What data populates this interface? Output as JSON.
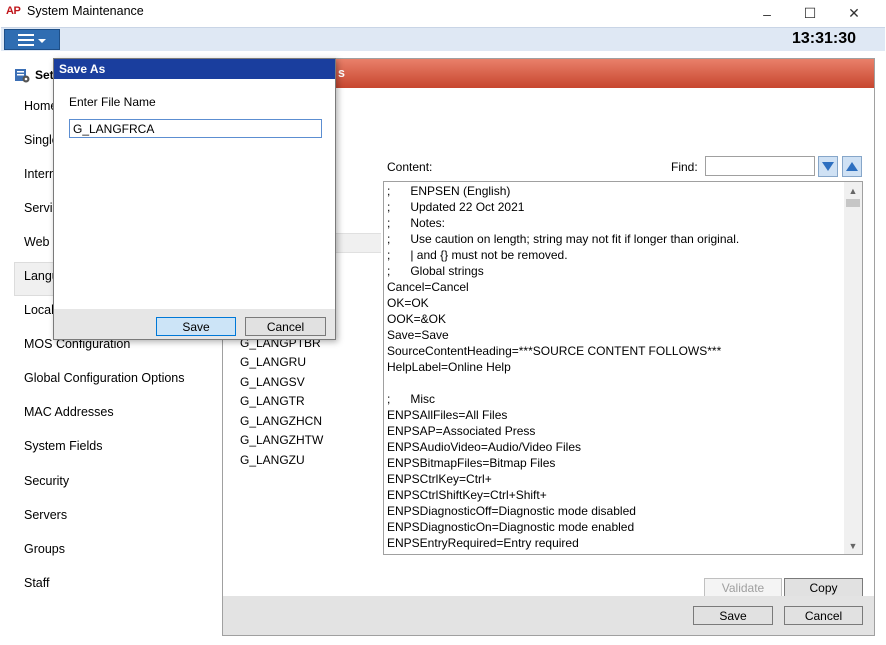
{
  "window": {
    "logo": "AP",
    "title": "System Maintenance",
    "minimize": "–",
    "maximize": "☐",
    "close": "✕"
  },
  "menustrip": {
    "clock": "13:31:30"
  },
  "sidebar": {
    "header": "Set",
    "items": [
      "Home",
      "Single",
      "Intern",
      "Servic",
      "Web S",
      "Langu",
      "Local",
      "MOS Configuration",
      "Global Configuration Options",
      "MAC Addresses",
      "System Fields",
      "Security",
      "Servers",
      "Groups",
      "Staff"
    ]
  },
  "main": {
    "header_visible": "s",
    "content_label": "Content:",
    "find_label": "Find:",
    "find_value": "",
    "languages": [
      "G_LANGPTBR",
      "G_LANGRU",
      "G_LANGSV",
      "G_LANGTR",
      "G_LANGZHCN",
      "G_LANGZHTW",
      "G_LANGZU"
    ],
    "content_lines": [
      ";      ENPSEN (English)",
      ";      Updated 22 Oct 2021",
      ";      Notes:",
      ";      Use caution on length; string may not fit if longer than original.",
      ";      | and {} must not be removed.",
      ";      Global strings",
      "Cancel=Cancel",
      "OK=OK",
      "OOK=&OK",
      "Save=Save",
      "SourceContentHeading=***SOURCE CONTENT FOLLOWS***",
      "HelpLabel=Online Help",
      "",
      ";      Misc",
      "ENPSAllFiles=All Files",
      "ENPSAP=Associated Press",
      "ENPSAudioVideo=Audio/Video Files",
      "ENPSBitmapFiles=Bitmap Files",
      "ENPSCtrlKey=Ctrl+",
      "ENPSCtrlShiftKey=Ctrl+Shift+",
      "ENPSDiagnosticOff=Diagnostic mode disabled",
      "ENPSDiagnosticOn=Diagnostic mode enabled",
      "ENPSEntryRequired=Entry required"
    ],
    "validate_label": "Validate",
    "copy_label": "Copy",
    "save_label": "Save",
    "cancel_label": "Cancel"
  },
  "dialog": {
    "title": "Save As",
    "prompt": "Enter File Name",
    "filename": "G_LANGFRCA",
    "save_label": "Save",
    "cancel_label": "Cancel"
  },
  "colors": {
    "header_red": "#c7462f",
    "dialog_title_blue": "#1a3e9e",
    "menu_button_blue": "#2f6db2",
    "menustrip_bg": "#dfe8f4"
  },
  "icons": [
    "app-logo",
    "menu-icon",
    "settings-icon",
    "arrow-down-icon",
    "arrow-up-icon"
  ]
}
